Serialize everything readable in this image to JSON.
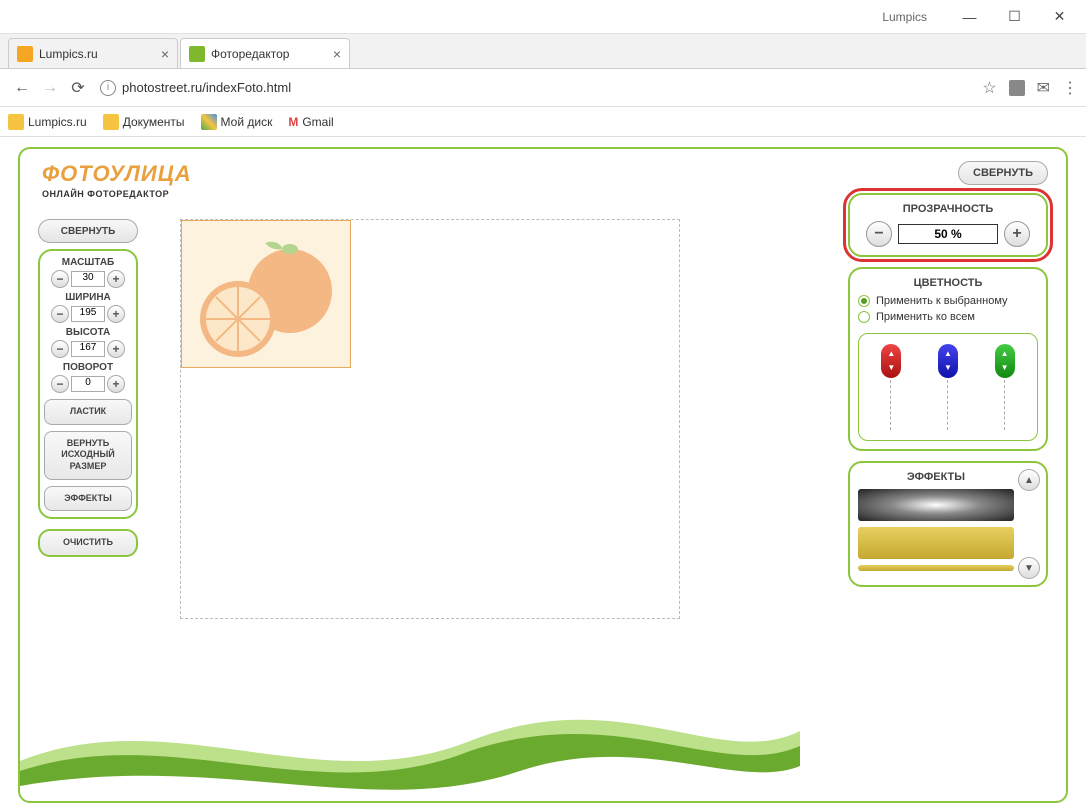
{
  "window": {
    "title": "Lumpics"
  },
  "tabs": [
    {
      "title": "Lumpics.ru",
      "active": false,
      "favicon": "#f5a623"
    },
    {
      "title": "Фоторедактор",
      "active": true,
      "favicon": "#7db82f"
    }
  ],
  "address": {
    "url": "photostreet.ru/indexFoto.html"
  },
  "bookmarks": [
    {
      "label": "Lumpics.ru",
      "color": "#f5c542"
    },
    {
      "label": "Документы",
      "color": "#f5c542"
    },
    {
      "label": "Мой диск",
      "color": "#4aa84a"
    },
    {
      "label": "Gmail",
      "color": "#d44"
    }
  ],
  "logo": {
    "main": "ФОТОУЛИЦА",
    "sub": "ОНЛАЙН ФОТОРЕДАКТОР"
  },
  "left": {
    "collapse": "СВЕРНУТЬ",
    "scale_label": "МАСШТАБ",
    "scale_value": "30",
    "width_label": "ШИРИНА",
    "width_value": "195",
    "height_label": "ВЫСОТА",
    "height_value": "167",
    "rotate_label": "ПОВОРОТ",
    "rotate_value": "0",
    "eraser": "ЛАСТИК",
    "restore": "ВЕРНУТЬ\nИСХОДНЫЙ\nРАЗМЕР",
    "effects": "ЭФФЕКТЫ",
    "clear": "ОЧИСТИТЬ"
  },
  "right": {
    "collapse": "СВЕРНУТЬ",
    "transparency_label": "ПРОЗРАЧНОСТЬ",
    "transparency_value": "50 %",
    "color_label": "ЦВЕТНОСТЬ",
    "apply_selected": "Применить к выбранному",
    "apply_all": "Применить ко всем",
    "effects_label": "ЭФФЕКТЫ"
  }
}
